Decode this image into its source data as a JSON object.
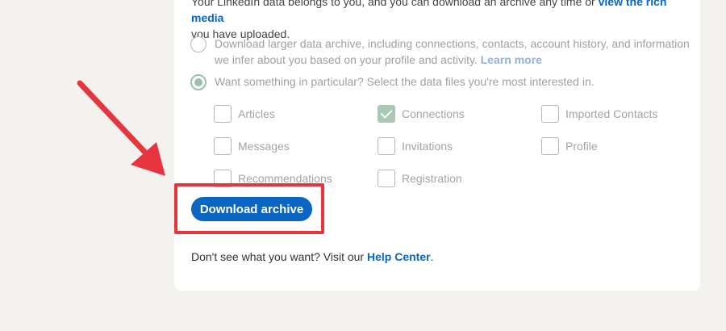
{
  "intro": {
    "line1_prefix": "Your LinkedIn data belongs to you, and you can download an archive any time or",
    "line1_link": "view the rich media",
    "line2": "you have uploaded."
  },
  "options": {
    "larger_archive": {
      "text": "Download larger data archive, including connections, contacts, account history, and information we infer about you based on your profile and activity.",
      "link": "Learn more",
      "selected": false
    },
    "particular": {
      "text": "Want something in particular? Select the data files you're most interested in.",
      "selected": true
    }
  },
  "checkboxes": [
    {
      "label": "Articles",
      "checked": false
    },
    {
      "label": "Connections",
      "checked": true
    },
    {
      "label": "Imported Contacts",
      "checked": false
    },
    {
      "label": "Messages",
      "checked": false
    },
    {
      "label": "Invitations",
      "checked": false
    },
    {
      "label": "Profile",
      "checked": false
    },
    {
      "label": "Recommendations",
      "checked": false
    },
    {
      "label": "Registration",
      "checked": false
    }
  ],
  "download_button": "Download archive",
  "footer": {
    "prefix": "Don't see what you want? Visit our",
    "link": "Help Center",
    "suffix": "."
  },
  "annotation": {
    "arrow_color": "#e53640",
    "highlight_color": "#e53640"
  },
  "colors": {
    "brand_blue": "#0a66c2",
    "page_bg": "#f3f2ef"
  }
}
